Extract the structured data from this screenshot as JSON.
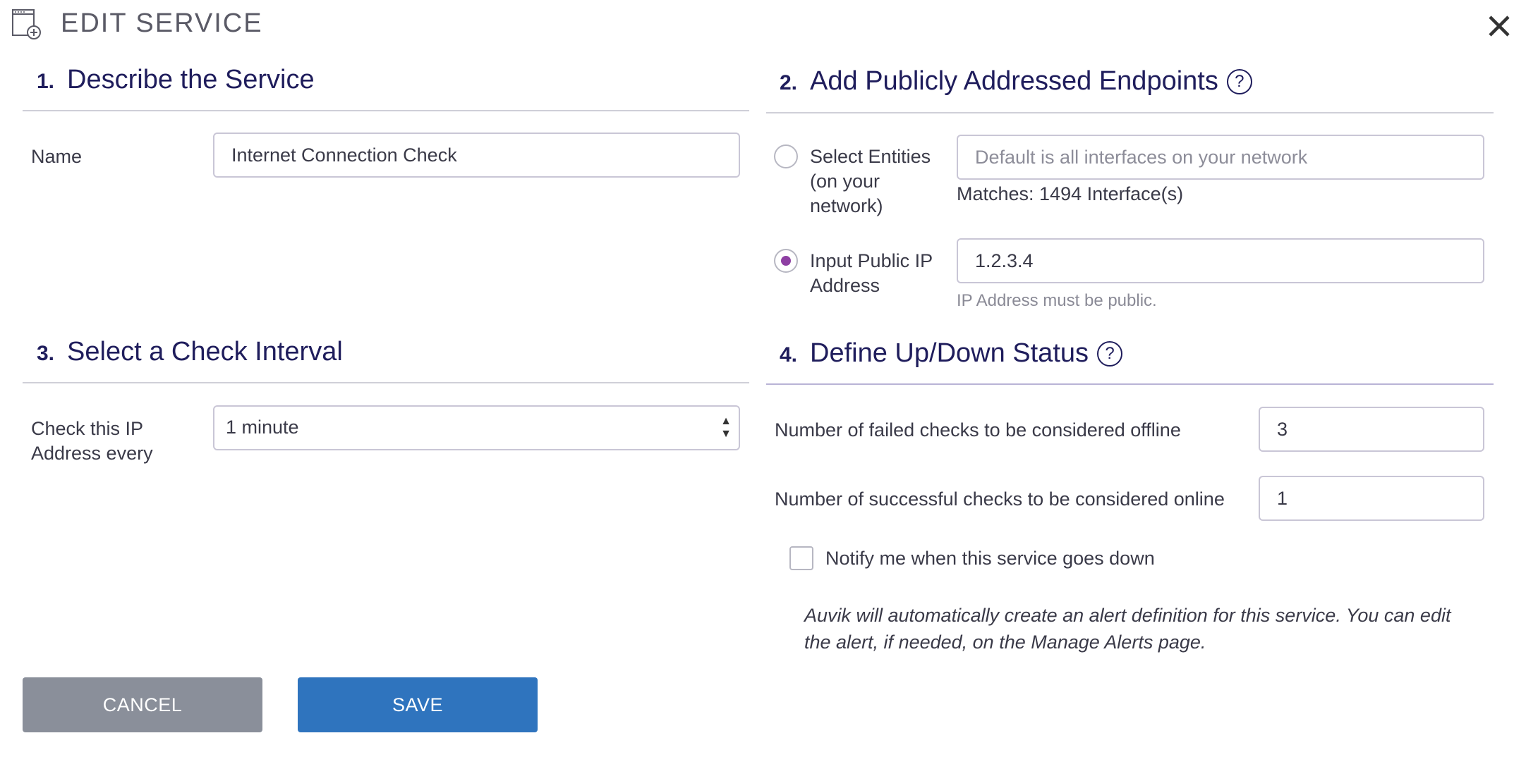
{
  "dialog": {
    "title": "EDIT SERVICE",
    "icon": "service-add-icon"
  },
  "section1": {
    "number": "1.",
    "title": "Describe the Service",
    "name_label": "Name",
    "name_value": "Internet Connection Check"
  },
  "section2": {
    "number": "2.",
    "title": "Add Publicly Addressed Endpoints",
    "help": "?",
    "option_entities": {
      "label_line1": "Select Entities",
      "label_line2": "(on your",
      "label_line3": "network)",
      "placeholder": "Default is all interfaces on your network",
      "selected": false
    },
    "matches": "Matches: 1494 Interface(s)",
    "option_ip": {
      "label_line1": "Input Public IP",
      "label_line2": "Address",
      "value": "1.2.3.4",
      "selected": true
    },
    "ip_hint": "IP Address must be public."
  },
  "section3": {
    "number": "3.",
    "title": "Select a Check Interval",
    "label_line1": "Check this IP",
    "label_line2": "Address every",
    "interval_value": "1 minute"
  },
  "section4": {
    "number": "4.",
    "title": "Define Up/Down Status",
    "help": "?",
    "failed_label": "Number of failed checks to be considered offline",
    "failed_value": "3",
    "success_label": "Number of successful checks to be considered online",
    "success_value": "1",
    "notify_label": "Notify me when this service goes down",
    "notify_checked": false,
    "note_line1": "Auvik will automatically create an alert definition for this service. You can edit",
    "note_line2": "the alert, if needed, on the Manage Alerts page."
  },
  "buttons": {
    "cancel": "CANCEL",
    "save": "SAVE"
  },
  "colors": {
    "heading": "#1f1d5c",
    "radio_selected": "#8e3fa3",
    "save_button": "#2f74be",
    "cancel_button": "#8a8f9a"
  }
}
